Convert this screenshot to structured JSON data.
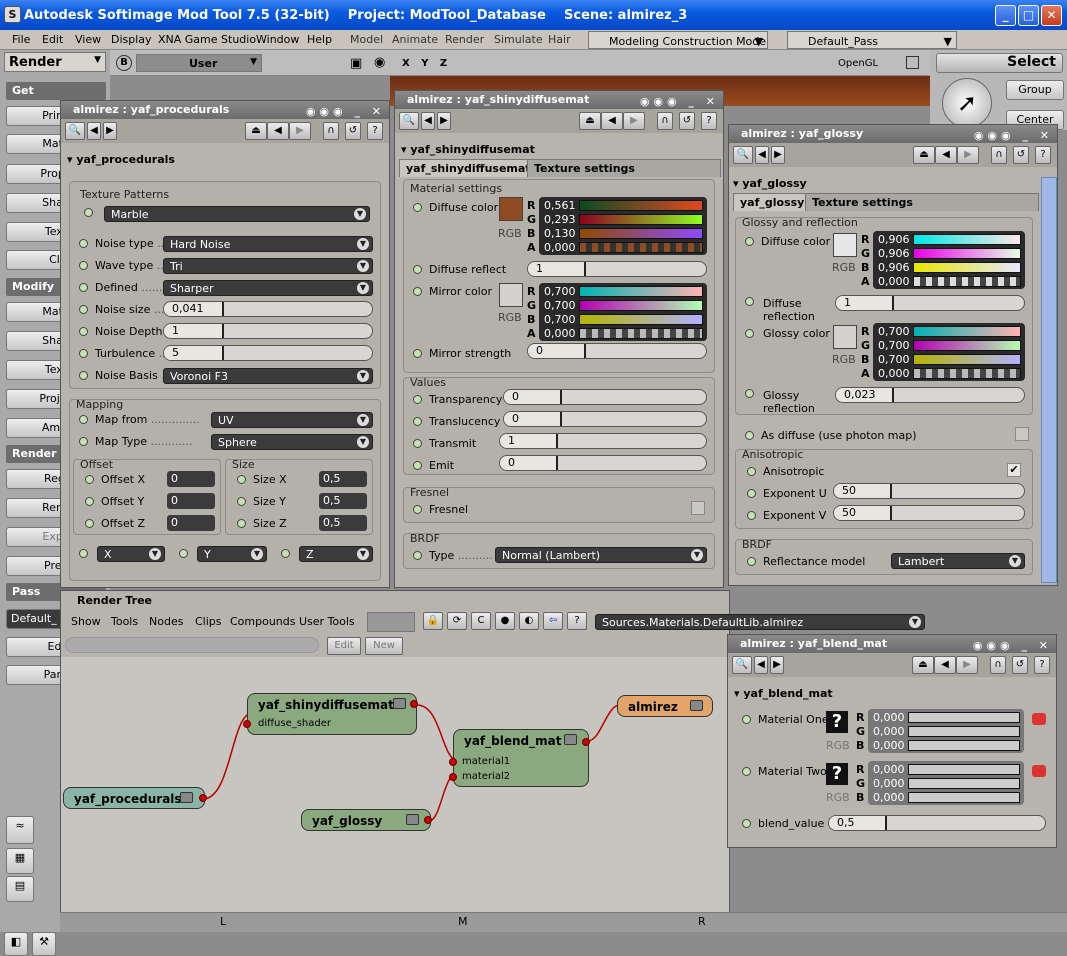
{
  "titlebar": {
    "app": "Autodesk Softimage Mod Tool 7.5 (32-bit)",
    "project": "Project: ModTool_Database",
    "scene": "Scene: almirez_3"
  },
  "menu": [
    "File",
    "Edit",
    "View",
    "Display",
    "XNA Game Studio",
    "Window",
    "Help",
    "Model",
    "Animate",
    "Render",
    "Simulate",
    "Hair"
  ],
  "mode": "Modeling Construction Mode",
  "pass": "Default_Pass",
  "viewport": {
    "camera": "User",
    "axes": "X Y Z",
    "renderer": "OpenGL"
  },
  "select_panel": {
    "title": "Select",
    "group": "Group",
    "center": "Center"
  },
  "left": {
    "render_combo": "Render",
    "get": "Get",
    "get_items": [
      "Primi",
      "Mate",
      "Prope",
      "Shad",
      "Text",
      "Cli"
    ],
    "modify": "Modify",
    "modify_items": [
      "Mate",
      "Shad",
      "Text",
      "Projec",
      "Ambi"
    ],
    "render": "Render",
    "render_items": [
      "Regi",
      "Rend",
      "Expo",
      "Prev"
    ],
    "pass": "Pass",
    "pass_items": [
      "Default_",
      "Edi",
      "Parti"
    ]
  },
  "procedurals": {
    "title": "almirez : yaf_procedurals",
    "node": "yaf_procedurals",
    "texture_patterns": "Texture Patterns",
    "pattern": "Marble",
    "noise_type_l": "Noise type",
    "noise_type": "Hard Noise",
    "wave_type_l": "Wave type",
    "wave_type": "Tri",
    "defined_l": "Defined",
    "defined": "Sharper",
    "noise_size_l": "Noise size",
    "noise_size": "0,041",
    "noise_depth_l": "Noise Depth",
    "noise_depth": "1",
    "turbulence_l": "Turbulence",
    "turbulence": "5",
    "noise_basis_l": "Noise Basis",
    "noise_basis": "Voronoi F3",
    "mapping": "Mapping",
    "map_from_l": "Map from",
    "map_from": "UV",
    "map_type_l": "Map Type",
    "map_type": "Sphere",
    "offset": "Offset",
    "size": "Size",
    "offset_x_l": "Offset X",
    "offset_x": "0",
    "offset_y_l": "Offset Y",
    "offset_y": "0",
    "offset_z_l": "Offset Z",
    "offset_z": "0",
    "size_x_l": "Size X",
    "size_x": "0,5",
    "size_y_l": "Size Y",
    "size_y": "0,5",
    "size_z_l": "Size Z",
    "size_z": "0,5",
    "axis_x": "X",
    "axis_y": "Y",
    "axis_z": "Z"
  },
  "shiny": {
    "title": "almirez : yaf_shinydiffusemat",
    "node": "yaf_shinydiffusemat",
    "tab1": "yaf_shinydiffusemat",
    "tab2": "Texture settings",
    "material_settings": "Material settings",
    "diffuse_color_l": "Diffuse color",
    "diffuse_color": {
      "R": "0,561",
      "G": "0,293",
      "B": "0,130",
      "A": "0,000"
    },
    "diffuse_reflect_l": "Diffuse reflect",
    "diffuse_reflect": "1",
    "mirror_color_l": "Mirror color",
    "mirror_color": {
      "R": "0,700",
      "G": "0,700",
      "B": "0,700",
      "A": "0,000"
    },
    "mirror_strength_l": "Mirror strength",
    "mirror_strength": "0",
    "values": "Values",
    "transparency_l": "Transparency",
    "transparency": "0",
    "translucency_l": "Translucency",
    "translucency": "0",
    "transmit_l": "Transmit",
    "transmit": "1",
    "emit_l": "Emit",
    "emit": "0",
    "fresnel": "Fresnel",
    "fresnel_l": "Fresnel",
    "brdf": "BRDF",
    "type_l": "Type",
    "type": "Normal (Lambert)",
    "rgb": "RGB",
    "diffuse_color_hex": "#8f4b21",
    "mirror_color_hex": "#d4d2ce"
  },
  "glossy": {
    "title": "almirez : yaf_glossy",
    "node": "yaf_glossy",
    "tab1": "yaf_glossy",
    "tab2": "Texture settings",
    "glossy_reflection": "Glossy and reflection",
    "diffuse_color_l": "Diffuse color",
    "diffuse_color": {
      "R": "0,906",
      "G": "0,906",
      "B": "0,906",
      "A": "0,000"
    },
    "diffuse_reflection_l1": "Diffuse",
    "diffuse_reflection_l2": "reflection",
    "diffuse_reflection": "1",
    "glossy_color_l": "Glossy color",
    "glossy_color": {
      "R": "0,700",
      "G": "0,700",
      "B": "0,700",
      "A": "0,000"
    },
    "glossy_reflection_l1": "Glossy",
    "glossy_reflection_l2": "reflection",
    "glossy_reflection_v": "0,023",
    "as_diffuse_l": "As diffuse (use photon map)",
    "anisotropic": "Anisotropic",
    "anisotropic_l": "Anisotropic",
    "exponent_u_l": "Exponent U",
    "exponent_u": "50",
    "exponent_v_l": "Exponent V",
    "exponent_v": "50",
    "brdf": "BRDF",
    "reflectance_l": "Reflectance model",
    "reflectance": "Lambert",
    "rgb": "RGB"
  },
  "blend": {
    "title": "almirez : yaf_blend_mat",
    "node": "yaf_blend_mat",
    "material_one_l": "Material One",
    "material_one": {
      "R": "0,000",
      "G": "0,000",
      "B": "0,000"
    },
    "material_two_l": "Material Two",
    "material_two": {
      "R": "0,000",
      "G": "0,000",
      "B": "0,000"
    },
    "blend_value_l": "blend_value",
    "blend_value": "0,5",
    "rgb": "RGB"
  },
  "render_tree": {
    "title": "Render Tree",
    "menu": [
      "Show",
      "Tools",
      "Nodes",
      "Clips",
      "Compounds",
      "User Tools"
    ],
    "path": "Sources.Materials.DefaultLib.almirez",
    "edit": "Edit",
    "new": "New",
    "nodes": {
      "shiny": "yaf_shinydiffusemat",
      "shiny_port": "diffuse_shader",
      "blend": "yaf_blend_mat",
      "blend_p1": "material1",
      "blend_p2": "material2",
      "almirez": "almirez",
      "procedurals": "yaf_procedurals",
      "glossy": "yaf_glossy"
    }
  },
  "timeline": {
    "l": "L",
    "m": "M",
    "r": "R"
  }
}
